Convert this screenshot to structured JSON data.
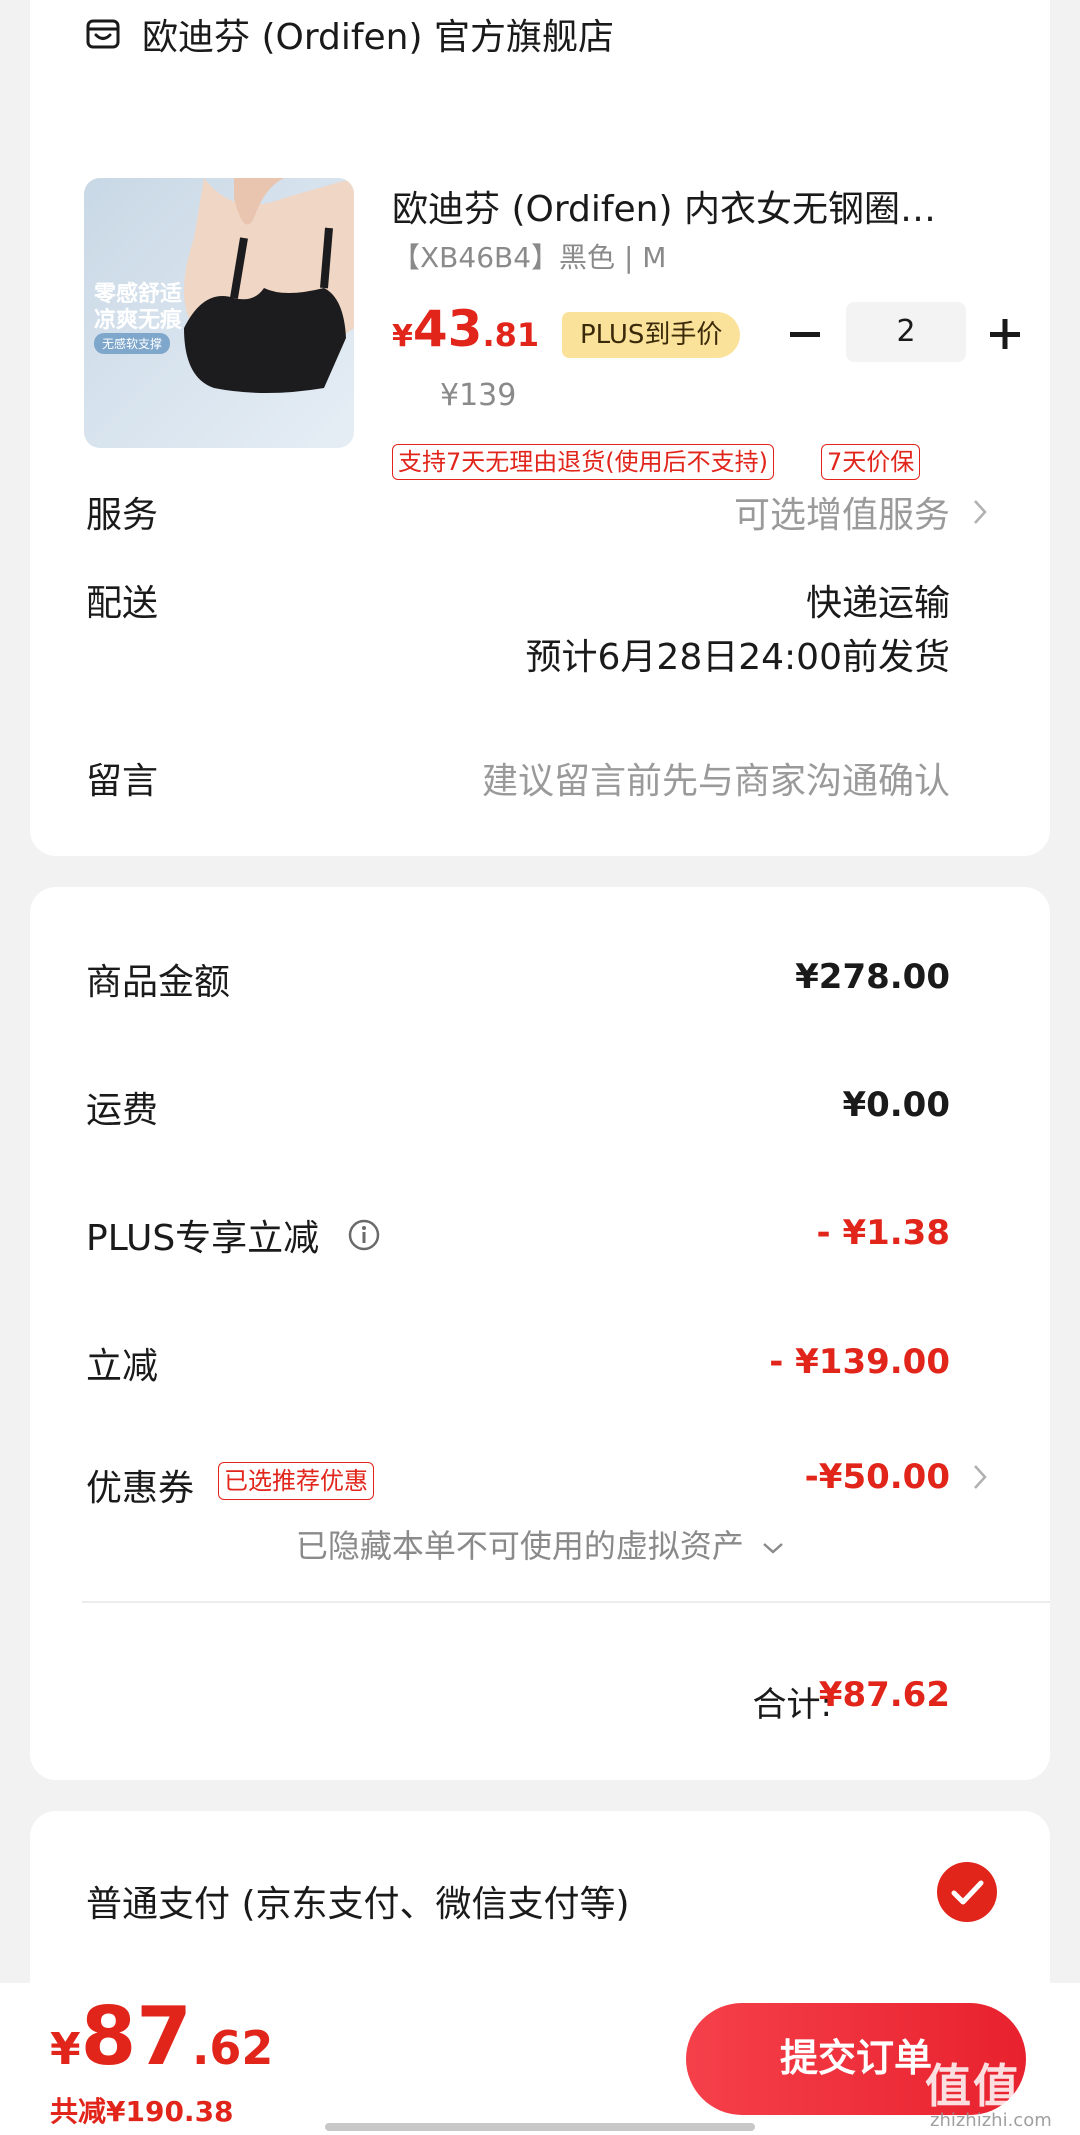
{
  "store": {
    "name": "欧迪芬 (Ordifen) 官方旗舰店"
  },
  "product": {
    "title": "欧迪芬 (Ordifen) 内衣女无钢圈…",
    "spec": "【XB46B4】黑色 | M",
    "image_text_1": "零感舒适",
    "image_text_2": "凉爽无痕",
    "image_text_3": "无感软支撑",
    "price_symbol": "¥",
    "price_int": "43",
    "price_dec": ".81",
    "plus_badge": "PLUS到手价",
    "original_price": "¥139",
    "quantity": "2",
    "tags": [
      "支持7天无理由退货(使用后不支持)",
      "7天价保"
    ]
  },
  "service": {
    "label": "服务",
    "value": "可选增值服务"
  },
  "delivery": {
    "label": "配送",
    "method": "快递运输",
    "eta": "预计6月28日24:00前发货"
  },
  "message": {
    "label": "留言",
    "placeholder": "建议留言前先与商家沟通确认"
  },
  "summary": {
    "rows": [
      {
        "label": "商品金额",
        "value": "¥278.00"
      },
      {
        "label": "运费",
        "value": "¥0.00"
      },
      {
        "label": "PLUS专享立减",
        "value": "- ¥1.38"
      },
      {
        "label": "立减",
        "value": "- ¥139.00"
      },
      {
        "label": "优惠券",
        "value": "-¥50.00",
        "tag": "已选推荐优惠"
      }
    ],
    "hidden_assets": "已隐藏本单不可使用的虚拟资产",
    "total_label": "合计:",
    "total_value": "¥87.62"
  },
  "payment": {
    "label": "普通支付 (京东支付、微信支付等)"
  },
  "bottom": {
    "price_symbol": "¥",
    "price_int": "87",
    "price_dec": ".62",
    "saved": "共减¥190.38",
    "submit_label": "提交订单",
    "watermark": "值值值",
    "watermark_sub": "zhizhizhi.com"
  },
  "colors": {
    "accent": "#e1251b",
    "plus_badge": "#fbe29a",
    "background": "#f2f2f2"
  }
}
